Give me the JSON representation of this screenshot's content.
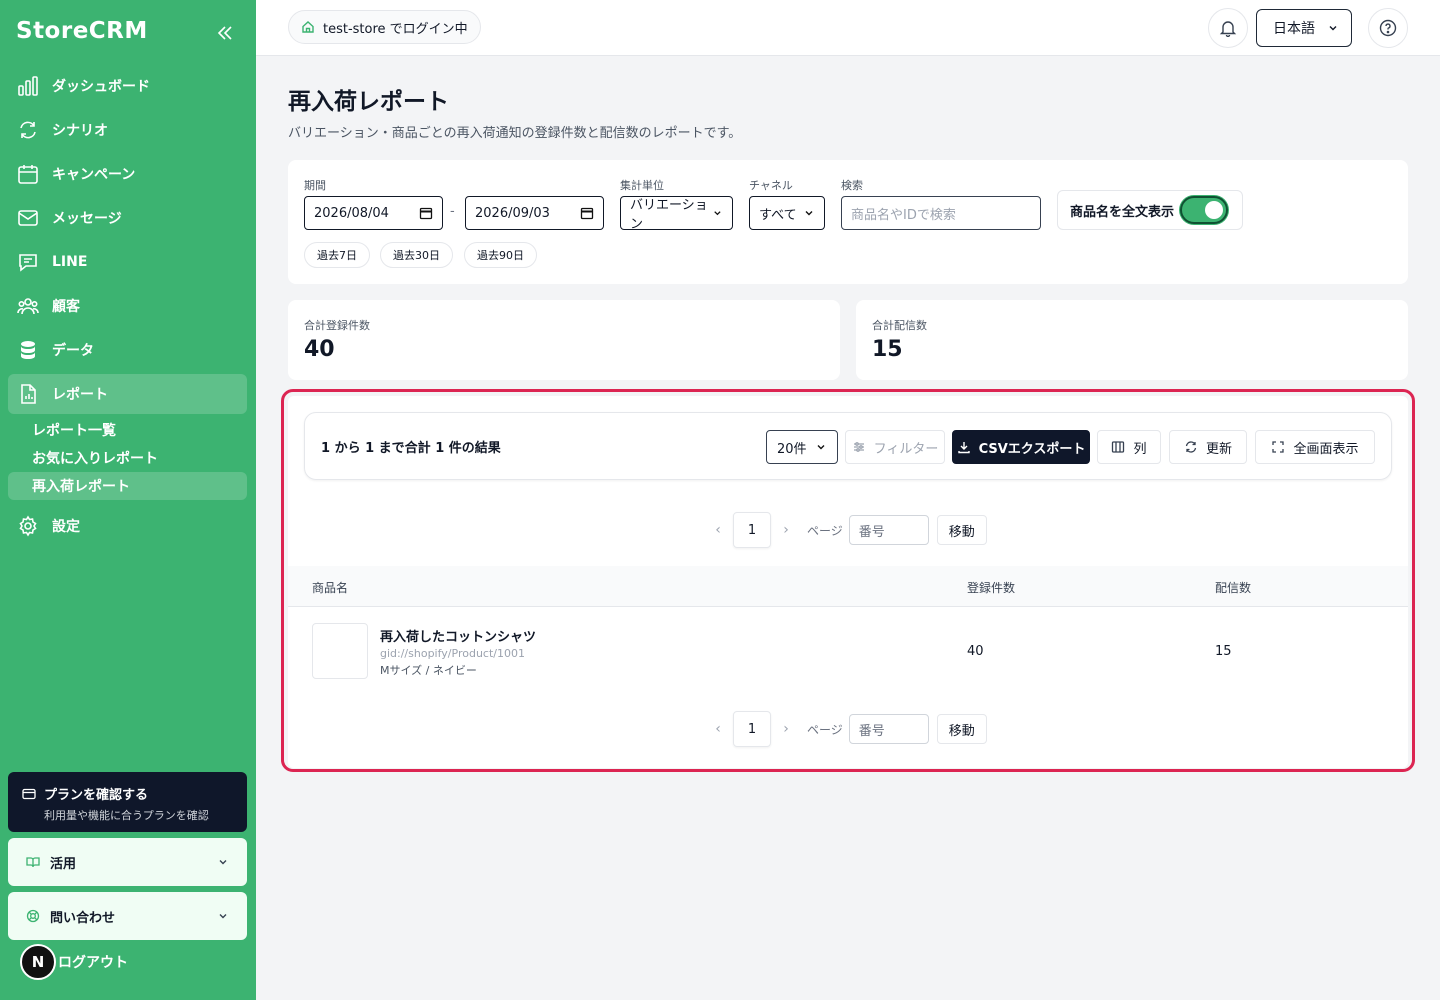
{
  "sidebar": {
    "brand": "StoreCRM",
    "nav": [
      {
        "label": "ダッシュボード",
        "icon": "bar-chart-icon"
      },
      {
        "label": "シナリオ",
        "icon": "repeat-icon"
      },
      {
        "label": "キャンペーン",
        "icon": "calendar-icon"
      },
      {
        "label": "メッセージ",
        "icon": "mail-icon"
      },
      {
        "label": "LINE",
        "icon": "chat-icon"
      },
      {
        "label": "顧客",
        "icon": "users-icon"
      },
      {
        "label": "データ",
        "icon": "database-icon"
      },
      {
        "label": "レポート",
        "icon": "report-icon"
      },
      {
        "label": "設定",
        "icon": "gear-icon"
      }
    ],
    "reports_sub": [
      "レポート一覧",
      "お気に入りレポート",
      "再入荷レポート"
    ],
    "plan": {
      "title": "プランを確認する",
      "subtitle": "利用量や機能に合うプランを確認"
    },
    "accordions": [
      "活用",
      "問い合わせ"
    ],
    "logout": "ログアウト",
    "avatar_letter": "N"
  },
  "topbar": {
    "store": "test-store でログイン中",
    "language": "日本語"
  },
  "page": {
    "title": "再入荷レポート",
    "description": "バリエーション・商品ごとの再入荷通知の登録件数と配信数のレポートです。"
  },
  "filters": {
    "period_label": "期間",
    "date_from": "2026/08/04",
    "date_to": "2026/09/03",
    "unit_label": "集計単位",
    "unit_value": "バリエーション",
    "channel_label": "チャネル",
    "channel_value": "すべて",
    "search_label": "検索",
    "search_placeholder": "商品名やIDで検索",
    "fulltext_toggle": "商品名を全文表示",
    "fulltext_on": true,
    "quick_ranges": [
      "過去7日",
      "過去30日",
      "過去90日"
    ]
  },
  "stats": {
    "registrations_label": "合計登録件数",
    "registrations_value": "40",
    "deliveries_label": "合計配信数",
    "deliveries_value": "15"
  },
  "results": {
    "summary": "1 から 1 まで合計 1 件の結果",
    "page_size": "20件",
    "filter_button": "フィルター",
    "csv_button": "CSVエクスポート",
    "columns_button": "列",
    "refresh_button": "更新",
    "fullscreen_button": "全画面表示",
    "pager": {
      "current": "1",
      "page_label": "ページ",
      "input_placeholder": "番号",
      "go_button": "移動"
    },
    "columns": [
      "商品名",
      "登録件数",
      "配信数"
    ],
    "rows": [
      {
        "name": "再入荷したコットンシャツ",
        "id": "gid://shopify/Product/1001",
        "variant": "Mサイズ / ネイビー",
        "registrations": "40",
        "deliveries": "15"
      }
    ]
  },
  "colors": {
    "sidebar": "#3cb371",
    "highlight": "#dc2552",
    "primary_button": "#0f172a"
  }
}
